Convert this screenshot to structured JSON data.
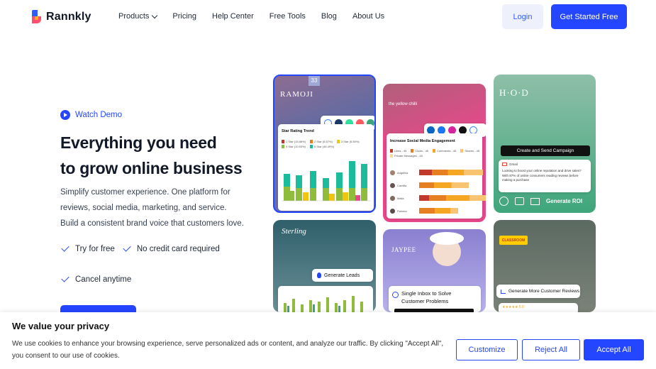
{
  "brand": {
    "name": "Rannkly"
  },
  "nav": {
    "items": [
      "Products",
      "Pricing",
      "Help Center",
      "Free Tools",
      "Blog",
      "About Us"
    ],
    "login": "Login",
    "get_started": "Get Started Free"
  },
  "hero": {
    "watch_demo": "Watch Demo",
    "headline_1": "Everything you need",
    "headline_2": "to grow online business",
    "sub_1": "Simplify customer experience. One platform for",
    "sub_2": "reviews, social media, marketing, and service.",
    "sub_3": "Build a consistent brand voice that customers love.",
    "check_1": "Try for free",
    "check_2": "No credit card required",
    "check_3": "Cancel anytime"
  },
  "cards": {
    "c1": {
      "brand": "RAMOJI",
      "badge": "33",
      "title": "Star Rating Trend",
      "legend": [
        "1 Star (15.88%)",
        "2 Star (5.57%)",
        "3 Star (5.55%)",
        "4 Star (10.53%)",
        "5 Star (46.49%)"
      ]
    },
    "c2": {
      "brand": "the yellow chilli",
      "title": "Increase Social Media Engagement",
      "legend": [
        "Likes - 45",
        "Clicks - 45",
        "Comments - 45",
        "Shares - 45",
        "Private Messages - 45"
      ],
      "people": [
        "Angelika",
        "Camilla",
        "Malia",
        "Paloma"
      ]
    },
    "c3": {
      "brand": "H·O·D",
      "campaign": "Create and Send Campaign",
      "gmail": "Gmail",
      "msg": "Looking to boost your online reputation and drive sales? With 87% of online consumers reading reviews before making a purchase",
      "cta": "Generate ROI"
    },
    "c4": {
      "brand": "Sterling",
      "badge": "Generate Leads"
    },
    "c5": {
      "brand": "JAYPEE",
      "title": "Single Inbox to Solve Customer Problems"
    },
    "c6": {
      "brand": "CLASSROOM",
      "title": "Generate More Customer Reviews",
      "rating": "★★★★★ 5.0"
    }
  },
  "cookie": {
    "title": "We value your privacy",
    "text": "We use cookies to enhance your browsing experience, serve personalized ads or content, and analyze our traffic. By clicking \"Accept All\", you consent to our use of cookies.",
    "customize": "Customize",
    "reject": "Reject All",
    "accept": "Accept All"
  },
  "colors": {
    "accent": "#2546ff",
    "pink": "#e8478b",
    "green": "#3fa67b",
    "orange": "#f08a2c"
  }
}
